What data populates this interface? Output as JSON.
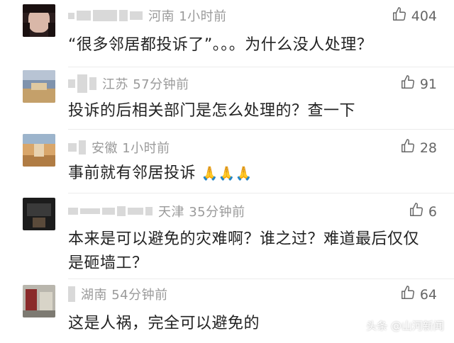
{
  "comments": [
    {
      "region_time": "河南 1小时前",
      "likes": "404",
      "text": "“很多邻居都投诉了”。。。为什么没人处理？"
    },
    {
      "region_time": "江苏 57分钟前",
      "likes": "91",
      "text": "投诉的后相关部门是怎么处理的？查一下"
    },
    {
      "region_time": "安徽 1小时前",
      "likes": "28",
      "text": "事前就有邻居投诉"
    },
    {
      "region_time": "天津 35分钟前",
      "likes": "6",
      "text": "本来是可以避免的灾难啊？谁之过？难道最后仅仅是砸墙工？"
    },
    {
      "region_time": "湖南 54分钟前",
      "likes": "64",
      "text": "这是人祸，完全可以避免的"
    }
  ],
  "watermark": "头条 @山河新闻",
  "colors": {
    "meta_gray": "#9a9a9a",
    "text_dark": "#222222",
    "like_gray": "#666666"
  },
  "icons": {
    "like": "thumbs-up-icon",
    "emoji": "folded-hands-icon"
  }
}
